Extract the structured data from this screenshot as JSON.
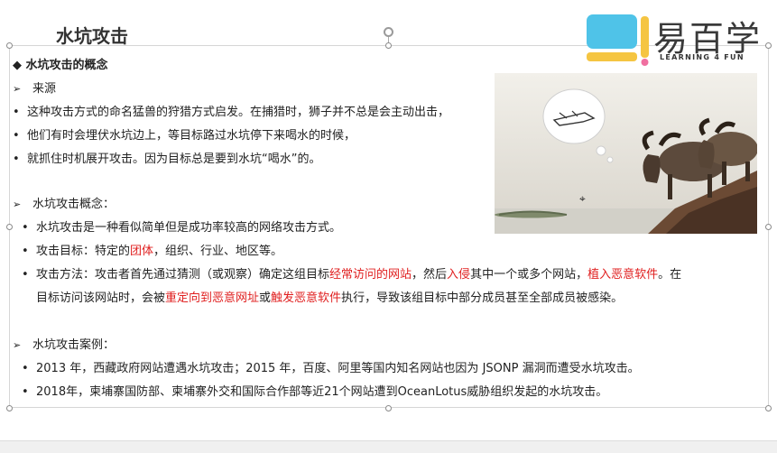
{
  "slide": {
    "title": "水坑攻击",
    "heading": "◆ 水坑攻击的概念",
    "section1": {
      "label": "来源",
      "items": [
        "这种攻击方式的命名猛兽的狩猎方式启发。在捕猎时，狮子并不总是会主动出击，",
        "他们有时会埋伏水坑边上，等目标路过水坑停下来喝水的时候，",
        "就抓住时机展开攻击。因为目标总是要到水坑“喝水”的。"
      ]
    },
    "section2": {
      "label": "水坑攻击概念：",
      "item1": "水坑攻击是一种看似简单但是成功率较高的网络攻击方式。",
      "item2": {
        "prefix": "攻击目标：特定的",
        "red": "团体",
        "suffix": "，组织、行业、地区等。"
      },
      "item3": {
        "p1": "攻击方法：攻击者首先通过猜测（或观察）确定这组目标",
        "r1": "经常访问的网站",
        "p2": "，然后",
        "r2": "入侵",
        "p3": "其中一个或多个网站，",
        "r3": "植入恶意软件",
        "p4": "。在",
        "p5": "目标访问该网站时，会被",
        "r4": "重定向到恶意网址",
        "p6": "或",
        "r5": "触发恶意软件",
        "p7": "执行，导致该组目标中部分成员甚至全部成员被感染。"
      }
    },
    "section3": {
      "label": "水坑攻击案例：",
      "items": [
        "2013 年，西藏政府网站遭遇水坑攻击；2015 年，百度、阿里等国内知名网站也因为 JSONP 漏洞而遭受水坑攻击。",
        "2018年，柬埔寨国防部、柬埔寨外交和国际合作部等近21个网站遭到OceanLotus威胁组织发起的水坑攻击。"
      ]
    }
  },
  "logo": {
    "cn_text": "易百学",
    "tagline": "LEARNING 4 FUN"
  },
  "colors": {
    "accent_red": "#e02020",
    "logo_blue": "#4fc3e8",
    "logo_yellow": "#f5c542",
    "logo_pink": "#f06fa0"
  },
  "icons": {
    "bullet": "small-dot",
    "sub": "arrow-right-outline",
    "cursor": "mouse-pointer"
  }
}
